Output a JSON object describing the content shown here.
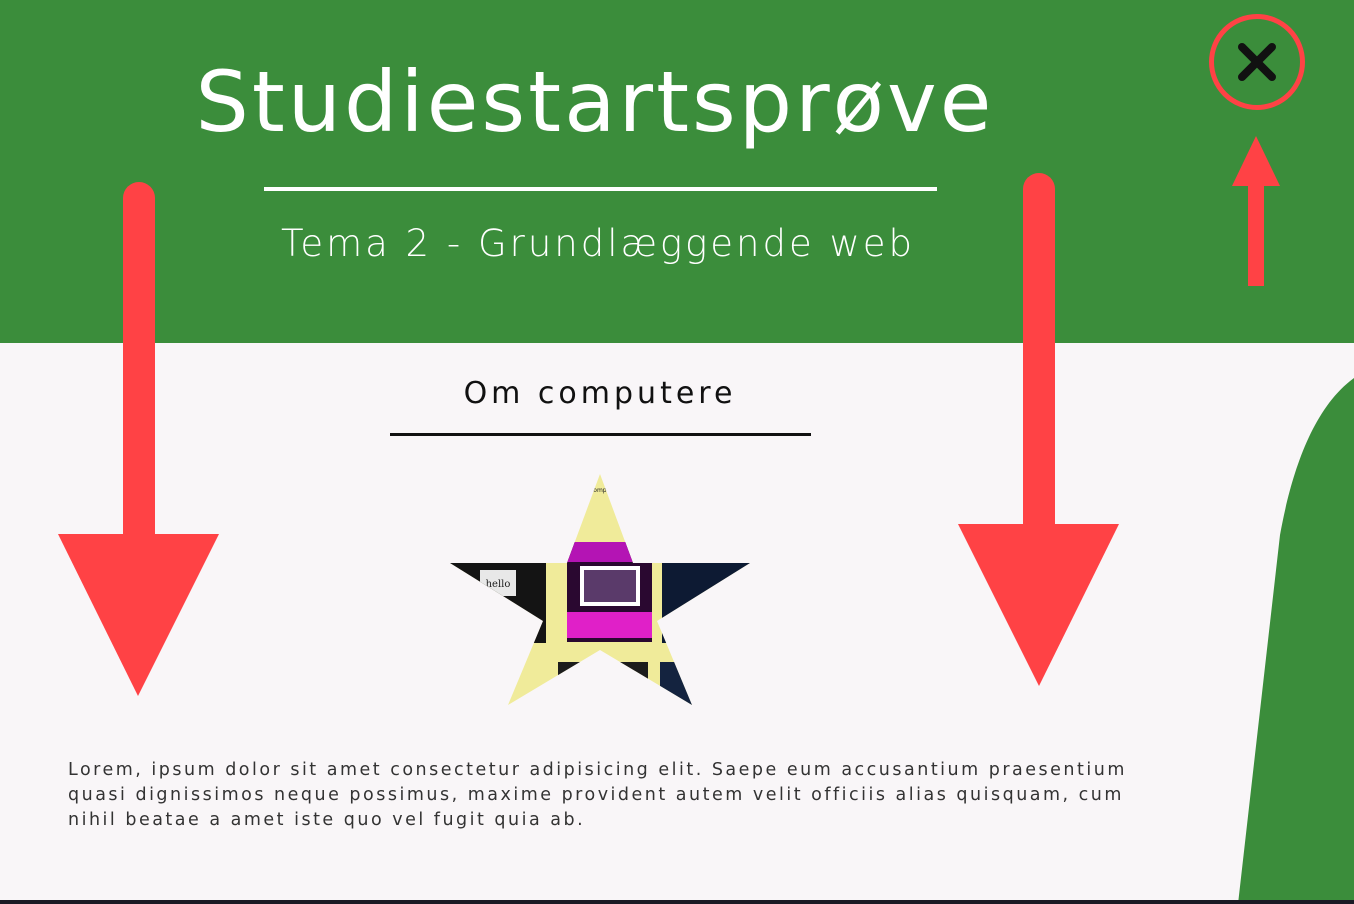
{
  "header": {
    "title": "Studiestartsprøve",
    "subtitle": "Tema 2 - Grundlæggende web"
  },
  "close_button": {
    "icon": "close-icon"
  },
  "section": {
    "title": "Om computere",
    "image_label": "Om computere",
    "body": "Lorem, ipsum dolor sit amet consectetur adipisicing elit. Saepe eum accusantium praesentium quasi dignissimos neque possimus, maxime provident autem velit officiis alias quisquam, cum nihil beatae a amet iste quo vel fugit quia ab."
  },
  "colors": {
    "header_green": "#3b8d3b",
    "background": "#f9f6f8",
    "accent_red": "#ff4245",
    "star_yellow": "#f0eb9a",
    "text_dark": "#111111"
  }
}
